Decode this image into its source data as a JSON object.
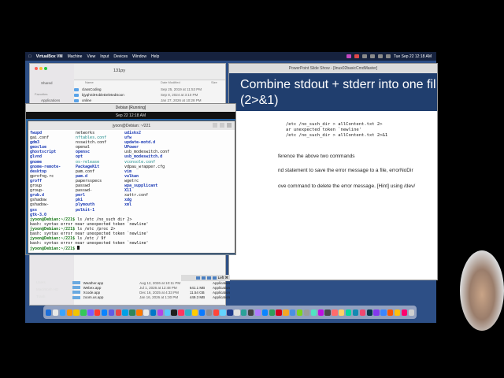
{
  "mac_menubar": {
    "items": [
      "VirtualBox VM",
      "Machine",
      "View",
      "Input",
      "Devices",
      "Window",
      "Help"
    ],
    "clock": "Tue Sep 22  12:18 AM"
  },
  "finder": {
    "sidebar": [
      "Shared",
      "Favorites",
      "Applications"
    ],
    "folder": "131py",
    "columns": {
      "name": "Name",
      "date": "Date Modified",
      "size": "Size"
    },
    "rows": [
      {
        "name": "classCoding",
        "date": "Sep 25, 2019 at 11:53 PM"
      },
      {
        "name": "bjyqhSiIHobleDeletedSoon",
        "date": "Sep 8, 2024 at 3:10 PM"
      },
      {
        "name": "online",
        "date": "Jan 27, 2026 at 10:28 PM"
      }
    ],
    "bottom_sidebar": [
      "Users",
      "Macintosh HD",
      "Trash"
    ],
    "bottom_rows": [
      {
        "name": "Weather.app",
        "date": "Aug 12, 2026 at 10:11 PM",
        "size": "",
        "kind": "Application"
      },
      {
        "name": "Webex.app",
        "date": "Jul 1, 2026 at 12:48 PM",
        "size": "641.1 MB",
        "kind": "Application"
      },
      {
        "name": "Xcode.app",
        "date": "Dec 16, 2025 at 4:33 PM",
        "size": "11.54 GB",
        "kind": "Application"
      },
      {
        "name": "zoom.us.app",
        "date": "Jan 16, 2026 at 1:30 PM",
        "size": "449.3 MB",
        "kind": "Application"
      }
    ]
  },
  "ppt": {
    "window_title": "PowerPoint Slide Show - [linux02basicCmdMaster]",
    "slide_title": "Combine stdout + stderr into one fil",
    "slide_sub": "(2>&1)",
    "code_lines": [
      "/etc /no_such_dir > allContent.txt 2>",
      "ar unexpected token `newline'",
      "/etc /no_such_dir > allContent.txt 2>&1"
    ],
    "bullets": [
      "ference the above two commands",
      "nd statement to save the error message to a file, errorNoDir",
      "ove command to delete the error message. [Hint] using /dev/"
    ]
  },
  "vbox": {
    "window_title": "Debian [Running]",
    "guest_clock": "Sep 22  12:18 AM",
    "status_host_key": "Left ⌘"
  },
  "terminal": {
    "title": "jyoon@Debian: ~/221",
    "col1": [
      "fwupd",
      "gai.conf",
      "gdm3",
      "geoclue",
      "ghostscript",
      "glvnd",
      "gnome",
      "gnome-remote-desktop",
      "gprofng.rc",
      "groff",
      "group",
      "group-",
      "grub.d",
      "gshadow",
      "gshadow-",
      "gss",
      "gtk-3.0"
    ],
    "col2": [
      "networks",
      "nftables.conf",
      "nsswitch.conf",
      "openal",
      "opensc",
      "opt",
      "os-release",
      "PackageKit",
      "pam.conf",
      "pam.d",
      "papersspecs",
      "passwd",
      "passwd-",
      "perl",
      "pki",
      "plymouth",
      "polkit-1"
    ],
    "col3": [
      "udisks2",
      "ufw",
      "update-motd.d",
      "UPower",
      "usb_modeswitch.conf",
      "usb_modeswitch.d",
      "vconsole.conf",
      "vdpau_wrapper.cfg",
      "vim",
      "vulkan",
      "wgetrc",
      "wpa_supplicant",
      "X11",
      "xattr.conf",
      "xdg",
      "xml",
      ""
    ],
    "prompt": "jyoon@Debian:~/221$",
    "cmd1": " ls /etc /no_such dir 2>",
    "err1": "bash: syntax error near unexpected token `newline'",
    "cmd2": " ls /etc /proc 2>",
    "err2": "bash: syntax error near unexpected token `newline'",
    "cmd3": " ls /etc / 9f",
    "err3": "bash: syntax error near unexpected token `newline'"
  },
  "colors": {
    "desktop": "#2d4f86",
    "slide_band": "#203e6e",
    "prompt": "#1a7a1a",
    "dir": "#1c3bb5"
  }
}
